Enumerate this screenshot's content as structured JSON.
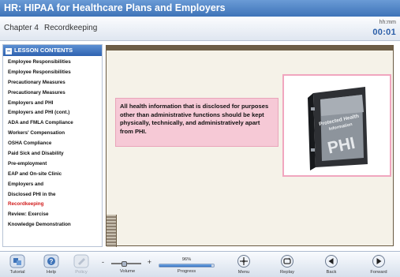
{
  "window": {
    "title": "HR: HIPAA for Healthcare Plans and Employers"
  },
  "chapter": {
    "number": "Chapter 4",
    "title": "Recordkeeping"
  },
  "timer": {
    "label": "hh:mm",
    "value": "00:01"
  },
  "sidebar": {
    "header": "LESSON CONTENTS",
    "items": [
      {
        "label": "Employee Responsibilities"
      },
      {
        "label": "Employee Responsibilities"
      },
      {
        "label": "Precautionary Measures"
      },
      {
        "label": "Precautionary Measures"
      },
      {
        "label": "Employers and PHI"
      },
      {
        "label": "Employers and PHI (cont.)"
      },
      {
        "label": "ADA and FMLA Compliance"
      },
      {
        "label": "Workers' Compensation"
      },
      {
        "label": "OSHA Compliance"
      },
      {
        "label": "Paid Sick and Disability"
      },
      {
        "label": "Pre-employment"
      },
      {
        "label": "EAP and On-site Clinic"
      },
      {
        "label": "Employers and"
      },
      {
        "label": "Disclosed PHI in the"
      },
      {
        "label": "Recordkeeping",
        "active": true
      },
      {
        "label": "Review: Exercise"
      },
      {
        "label": "Knowledge Demonstration"
      }
    ]
  },
  "slide": {
    "callout_text": "All health information that is disclosed for purposes other than administrative functions should be kept physically, technically, and administratively apart from PHI.",
    "binder": {
      "spine_text_1": "Protected Health",
      "spine_text_2": "Information",
      "cover_text": "PHI"
    }
  },
  "toolbar": {
    "tutorial_label": "Tutorial",
    "help_label": "Help",
    "policy_label": "Policy",
    "volume_label": "Volume",
    "volume_minus": "-",
    "volume_plus": "+",
    "volume_level": 0.45,
    "progress_label": "Progress",
    "progress_percent_text": "96%",
    "progress_value": 0.96,
    "menu_label": "Menu",
    "replay_label": "Replay",
    "back_label": "Back",
    "forward_label": "Forward"
  },
  "colors": {
    "title_bar": "#3e73b8",
    "active_lesson": "#d11a1a",
    "callout_bg": "#f6c9d6",
    "frame_border": "#f1a6bf",
    "progress_fill": "#2f6dc0"
  }
}
